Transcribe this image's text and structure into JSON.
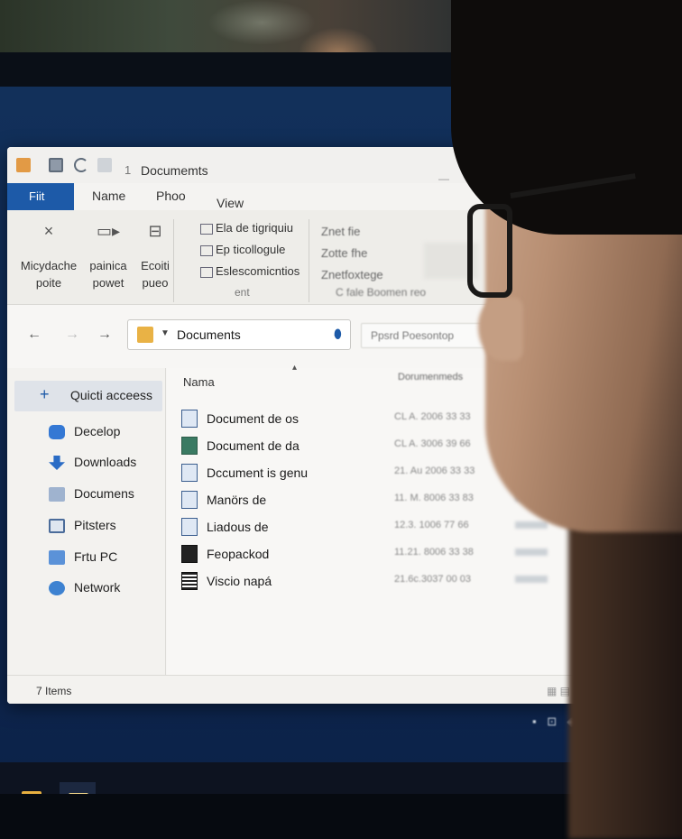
{
  "window": {
    "title": "Documemts",
    "separator": "1"
  },
  "ribbon_tabs": {
    "file": "Fiit",
    "home": "Name",
    "share": "Phoo",
    "view": "View"
  },
  "ribbon": {
    "buttons": [
      {
        "icon": "×",
        "line1": "Micydache",
        "line2": "poite"
      },
      {
        "icon": "▭▸",
        "line1": "painica",
        "line2": "powet"
      },
      {
        "icon": "⊟",
        "line1": "Ecoiti",
        "line2": "pueo"
      }
    ],
    "list": [
      "Ela de tigriquiu",
      "Ep ticollogule",
      "Eslescomicntios"
    ],
    "group_label": "ent",
    "list2": [
      "Znet fie",
      "Zotte fhe",
      "Znetfoxtege"
    ],
    "group_label2": "C fale Boomen reo"
  },
  "nav": {
    "back_icon": "←",
    "forward_icon": "→",
    "up_icon": "→",
    "address": "Documents",
    "search_placeholder": "Ppsrd Poesontop"
  },
  "sidebar": {
    "quick_access": "Quicti acceess",
    "items": [
      {
        "label": "Decelop",
        "icon": "desktop-icon"
      },
      {
        "label": "Downloads",
        "icon": "download-icon"
      },
      {
        "label": "Documens",
        "icon": "documents-icon"
      },
      {
        "label": "Pitsters",
        "icon": "pictures-icon"
      },
      {
        "label": "Frtu PC",
        "icon": "pc-icon"
      },
      {
        "label": "Network",
        "icon": "network-icon"
      }
    ]
  },
  "filelist": {
    "columns": {
      "name": "Nama",
      "date": "Dorumenmeds"
    },
    "rows": [
      {
        "name": "Document de os",
        "date": "CL A. 2006 33 33",
        "icon": "doc"
      },
      {
        "name": "Document de da",
        "date": "CL A. 3006 39 66",
        "icon": "green"
      },
      {
        "name": "Dccument is genu",
        "date": "21. Au 2006 33 33",
        "icon": "doc"
      },
      {
        "name": "Manörs de",
        "date": "11. M. 8006 33 83",
        "icon": "doc"
      },
      {
        "name": "Liadous de",
        "date": "12.3. 1006 77 66",
        "icon": "doc"
      },
      {
        "name": "Feopackod",
        "date": "11.21. 8006 33 38",
        "icon": "black"
      },
      {
        "name": "Viscio napá",
        "date": "21.6c.3037 00 03",
        "icon": "lines"
      }
    ]
  },
  "status": {
    "items_count": "7 Items"
  },
  "colors": {
    "accent": "#1d5aa8",
    "folder": "#e9b245",
    "desktop_bg": "#0f2a55"
  }
}
